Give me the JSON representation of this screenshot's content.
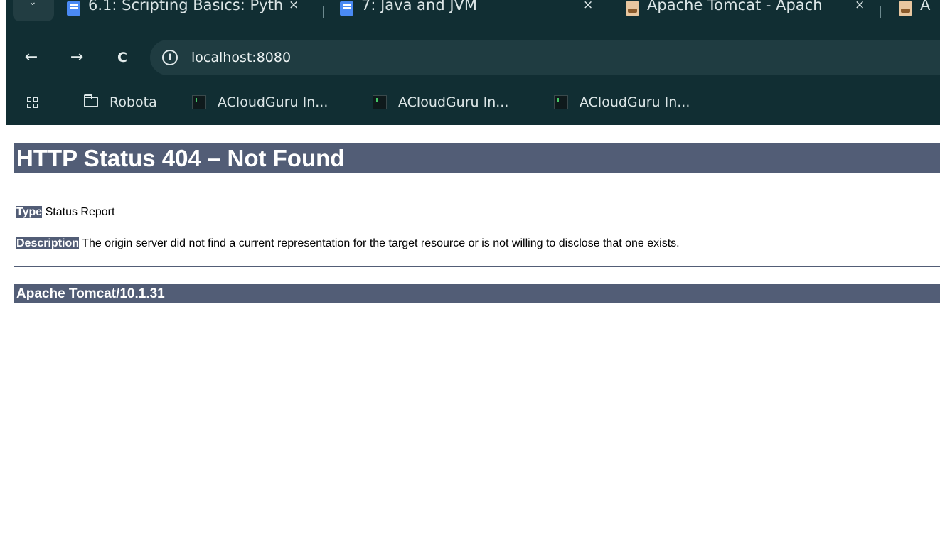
{
  "browser": {
    "tabs": [
      {
        "title": "6.1: Scripting Basics: Pyth",
        "favicon": "docs-icon"
      },
      {
        "title": "7: Java and JVM",
        "favicon": "docs-icon"
      },
      {
        "title": "Apache Tomcat - Apach",
        "favicon": "tomcat-icon"
      },
      {
        "title": "A",
        "favicon": "tomcat-icon"
      }
    ],
    "tab_close_glyph": "×",
    "nav": {
      "back": "←",
      "forward": "→",
      "reload": "C"
    },
    "address": {
      "info_glyph": "i",
      "url": "localhost:8080"
    },
    "bookmarks": [
      {
        "label": "Robota",
        "icon": "folder-icon"
      },
      {
        "label": "ACloudGuru In...",
        "icon": "terminal-icon"
      },
      {
        "label": "ACloudGuru In...",
        "icon": "terminal-icon"
      },
      {
        "label": "ACloudGuru In...",
        "icon": "terminal-icon"
      }
    ],
    "colors": {
      "chrome": "#112e33",
      "address_bar": "#1f3c41"
    }
  },
  "page": {
    "heading": "HTTP Status 404 – Not Found",
    "type_label": "Type",
    "type_value": "Status Report",
    "description_label": "Description",
    "description_value": "The origin server did not find a current representation for the target resource or is not willing to disclose that one exists.",
    "footer": "Apache Tomcat/10.1.31",
    "colors": {
      "header_bg": "#525d76",
      "header_text": "#ffffff"
    }
  }
}
